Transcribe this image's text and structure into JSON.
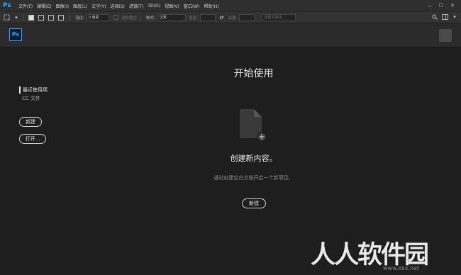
{
  "app": {
    "logo_text": "Ps",
    "menu": [
      "文件(F)",
      "编辑(E)",
      "图像(I)",
      "图层(L)",
      "文字(Y)",
      "选择(S)",
      "滤镜(T)",
      "3D(D)",
      "视图(V)",
      "窗口(W)",
      "帮助(H)"
    ],
    "window_controls": [
      "—",
      "☐",
      "✕"
    ]
  },
  "toolbar": {
    "feather_label": "羽化:",
    "feather_value": "0 像素",
    "antialias_label": "消除锯齿",
    "style_label": "样式:",
    "style_value": "正常",
    "width_label": "宽度:",
    "height_label": "高度:",
    "select_mask_label": "选择并遮住..."
  },
  "sidebar": {
    "recent_label": "最近使用项",
    "cc_files_label": "CC 文件",
    "new_button": "新建",
    "open_button": "打开..."
  },
  "main": {
    "title": "开始使用",
    "heading": "创建新内容。",
    "description": "通过创建空白文档开启一个新项目。",
    "new_button": "新建"
  },
  "watermark": {
    "text": "人人软件园",
    "url": "www.kkx.net"
  },
  "colors": {
    "accent": "#31a8ff",
    "background": "#1e1e1e"
  }
}
